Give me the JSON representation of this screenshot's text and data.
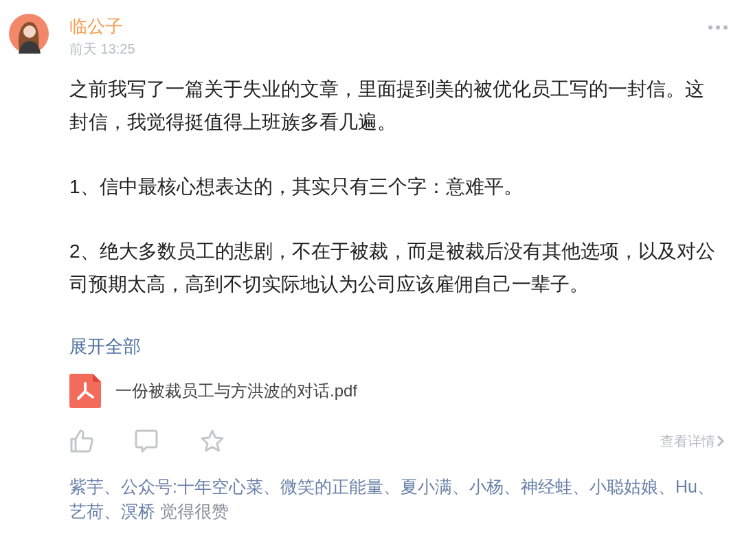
{
  "post": {
    "author": "临公子",
    "time": "前天 13:25",
    "paragraphs": [
      "之前我写了一篇关于失业的文章，里面提到美的被优化员工写的一封信。这封信，我觉得挺值得上班族多看几遍。",
      "1、信中最核心想表达的，其实只有三个字：意难平。",
      "2、绝大多数员工的悲剧，不在于被裁，而是被裁后没有其他选项，以及对公司预期太高，高到不切实际地认为公司应该雇佣自己一辈子。"
    ],
    "expand_link": "展开全部",
    "attachment": {
      "name": "一份被裁员工与方洪波的对话.pdf"
    },
    "details_link": "查看详情",
    "liked_by": "紫芋、公众号:十年空心菜、微笑的正能量、夏小满、小杨、神经蛙、小聪姑娘、Hu、艺荷、溟桥",
    "liked_suffix": "觉得很赞"
  }
}
